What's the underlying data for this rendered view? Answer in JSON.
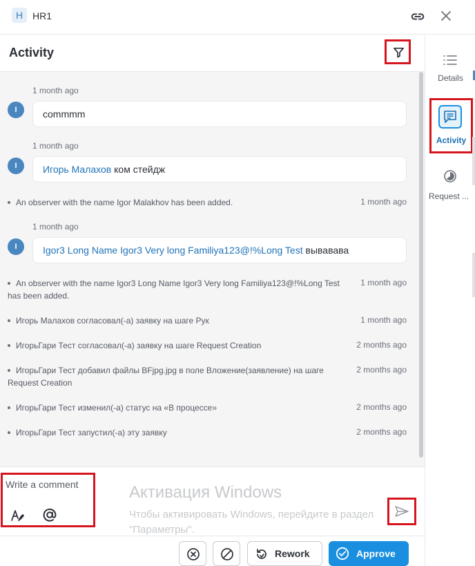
{
  "window": {
    "badge": "H",
    "title": "HR1"
  },
  "activity": {
    "title": "Activity",
    "items": [
      {
        "type": "comment",
        "time": "1 month ago",
        "avatar": "I",
        "text": "commmm"
      },
      {
        "type": "comment",
        "time": "1 month ago",
        "avatar": "I",
        "mention": "Игорь Малахов",
        "text": " ком стейдж"
      },
      {
        "type": "event",
        "text": "An observer with the name Igor Malakhov has been added.",
        "time": "1 month ago"
      },
      {
        "type": "comment",
        "time": "1 month ago",
        "avatar": "I",
        "mention": "Igor3 Long Name Igor3 Very long Familiya123@!%Long Test",
        "text": " вывавава"
      },
      {
        "type": "event",
        "text": "An observer with the name Igor3 Long Name Igor3 Very long Familiya123@!%Long Test has been added.",
        "time": "1 month ago"
      },
      {
        "type": "event",
        "text": "Игорь Малахов согласовал(-а) заявку на шаге Рук",
        "time": "1 month ago"
      },
      {
        "type": "event",
        "text": "ИгорьГари Тест согласовал(-а) заявку на шаге Request Creation",
        "time": "2 months ago"
      },
      {
        "type": "event",
        "text": "ИгорьГари Тест добавил файлы BFjpg.jpg в поле Вложение(заявление) на шаге Request Creation",
        "time": "2 months ago"
      },
      {
        "type": "event",
        "text": "ИгорьГари Тест изменил(-а) статус на «В процессе»",
        "time": "2 months ago"
      },
      {
        "type": "event",
        "text": "ИгорьГари Тест запустил(-а) эту заявку",
        "time": "2 months ago"
      }
    ]
  },
  "composer": {
    "placeholder": "Write a comment"
  },
  "watermark": {
    "title": "Активация Windows",
    "line1": "Чтобы активировать Windows, перейдите в раздел",
    "line2": "\"Параметры\"."
  },
  "footer": {
    "rework_label": "Rework",
    "approve_label": "Approve"
  },
  "rail": {
    "details_label": "Details",
    "activity_label": "Activity",
    "request_label": "Request ..."
  },
  "colors": {
    "accent": "#1a8fe0",
    "highlight": "#d5141d",
    "mention": "#2173b8"
  }
}
